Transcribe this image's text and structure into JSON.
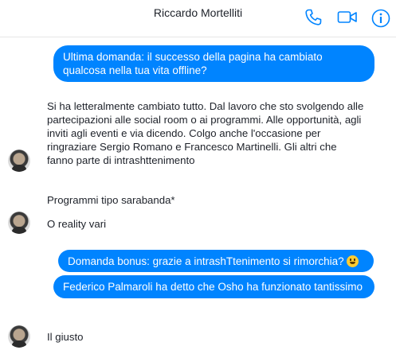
{
  "header": {
    "contact_name": "Riccardo Mortelliti",
    "icons": [
      "phone-icon",
      "video-camera-icon",
      "info-icon"
    ],
    "accent_color": "#0084ff"
  },
  "messages": [
    {
      "sender": "self",
      "text": "Ultima domanda: il successo della pagina ha cambiato qualcosa nella tua vita offline?"
    },
    {
      "sender": "contact",
      "text": "Si ha letteralmente cambiato tutto. Dal lavoro che sto svolgendo alle partecipazioni alle social room o ai programmi. Alle opportunità, agli inviti agli eventi e via dicendo. Colgo anche l'occasione per ringraziare Sergio Romano e Francesco Martinelli. Gli altri che fanno parte di intrashttenimento"
    },
    {
      "sender": "contact",
      "text": "Programmi tipo sarabanda*"
    },
    {
      "sender": "contact",
      "text": "O reality vari"
    },
    {
      "sender": "self",
      "text": "Domanda bonus: grazie a intrashTtenimento si rimorchia?",
      "emoji": "grinning-face-emoji"
    },
    {
      "sender": "self",
      "text": "Federico Palmaroli ha detto che Osho ha funzionato tantissimo"
    },
    {
      "sender": "contact",
      "text": "Il giusto"
    }
  ]
}
